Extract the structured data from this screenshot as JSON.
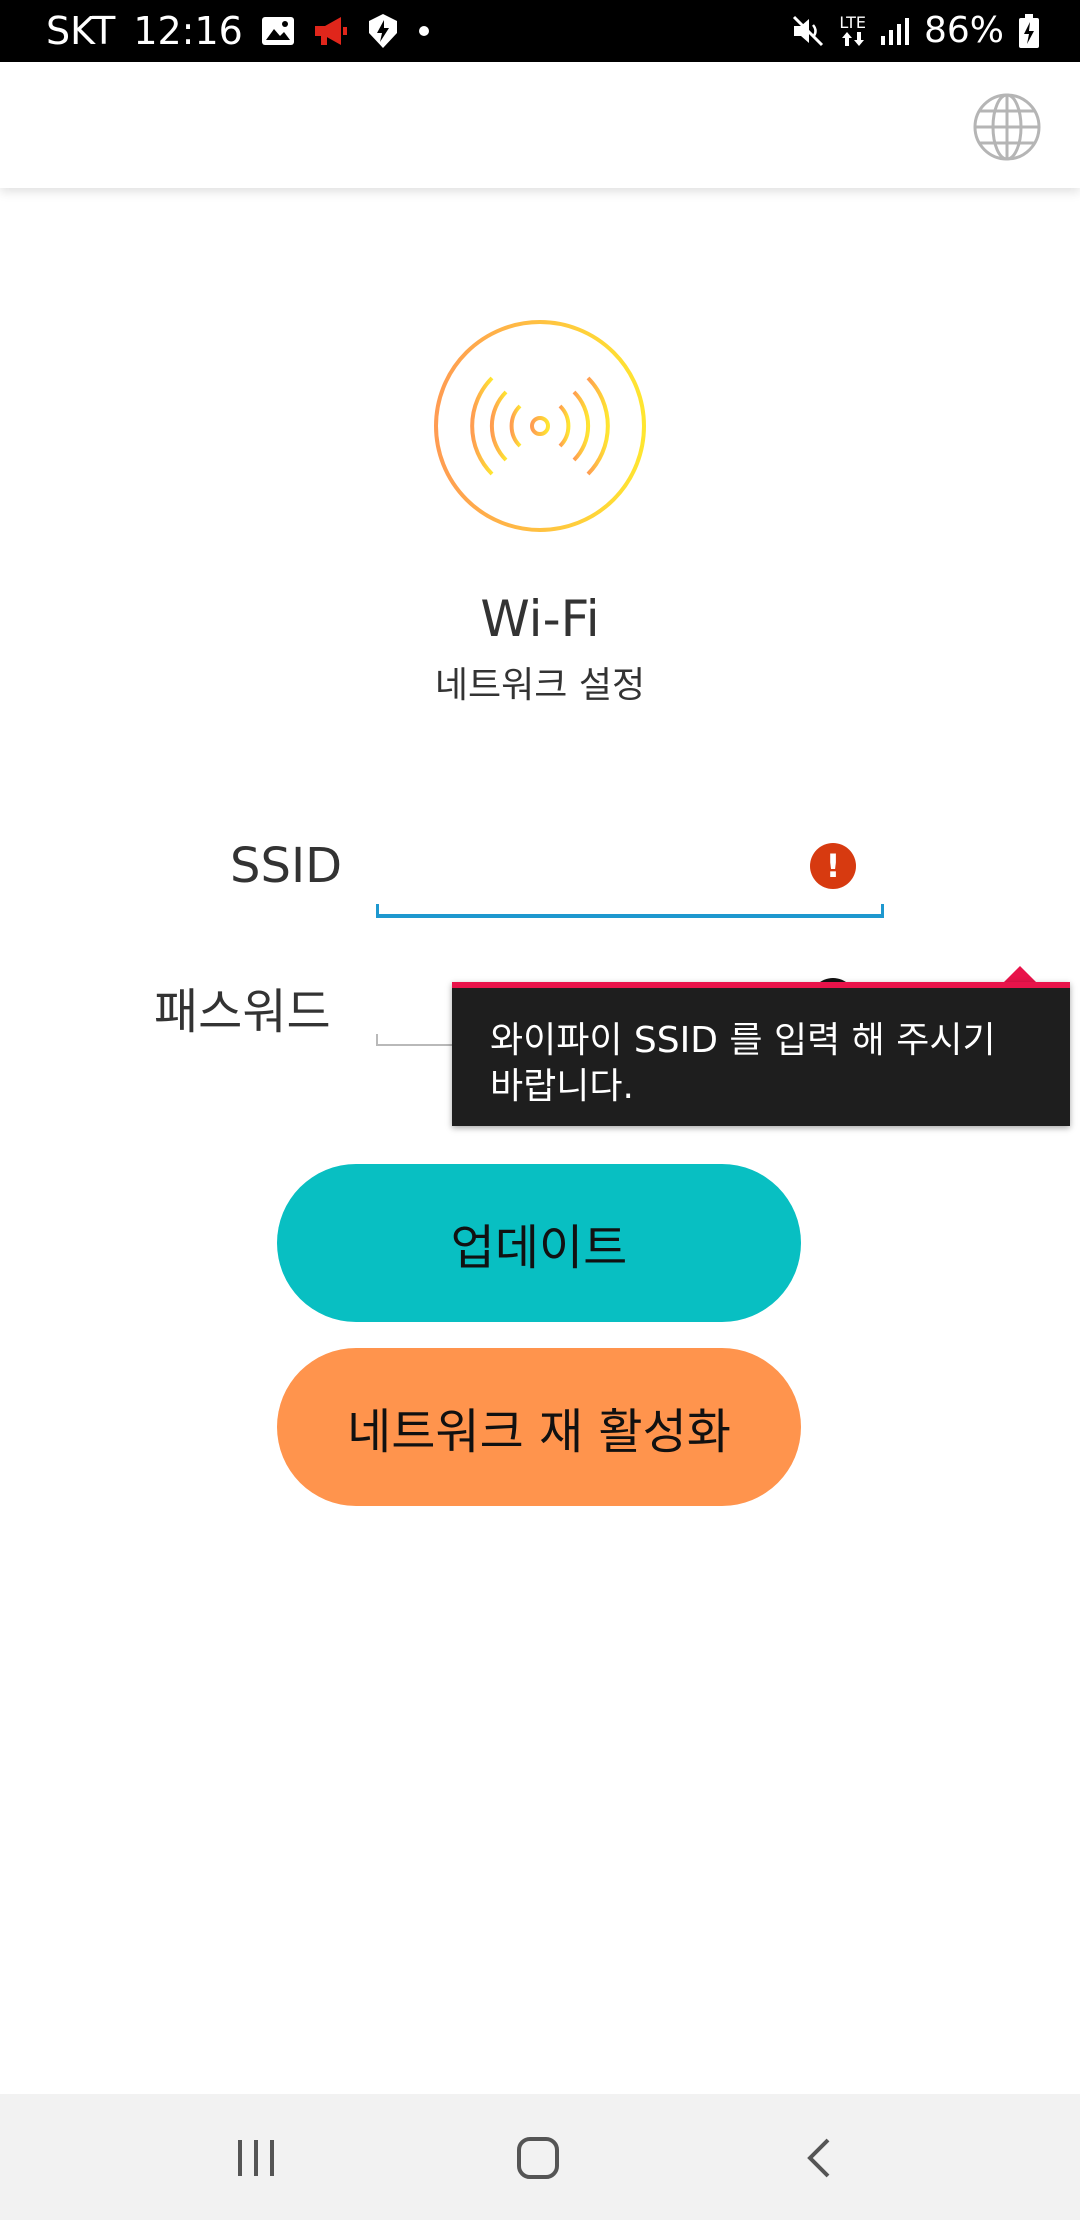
{
  "status_bar": {
    "carrier": "SKT",
    "time": "12:16",
    "network": "LTE",
    "battery": "86%",
    "icons": [
      "gallery-icon",
      "megaphone-icon",
      "shield-icon",
      "dot-icon",
      "mute-icon",
      "lte-icon",
      "signal-icon",
      "battery-charging-icon"
    ],
    "colors": {
      "background": "#000000",
      "megaphone": "#e0261b"
    }
  },
  "app_bar": {
    "icon": "globe-icon"
  },
  "hero": {
    "icon": "wifi-hotspot-icon",
    "title": "Wi-Fi",
    "subtitle": "네트워크 설정"
  },
  "form": {
    "ssid_label": "SSID",
    "ssid_value": "",
    "password_label": "패스워드",
    "password_value": "",
    "error_icon": "error-icon"
  },
  "tooltip": {
    "text": "와이파이 SSID 를 입력 해 주시기 바랍니다."
  },
  "buttons": {
    "update": "업데이트",
    "reactivate": "네트워크 재 활성화"
  },
  "nav_bar": {
    "icons": [
      "recents-icon",
      "home-icon",
      "back-icon"
    ]
  },
  "colors": {
    "accent_teal": "#08bfc2",
    "accent_orange": "#ff944d",
    "focus_line": "#1e98cf",
    "error": "#d73a10",
    "tooltip_border": "#e8134a"
  }
}
